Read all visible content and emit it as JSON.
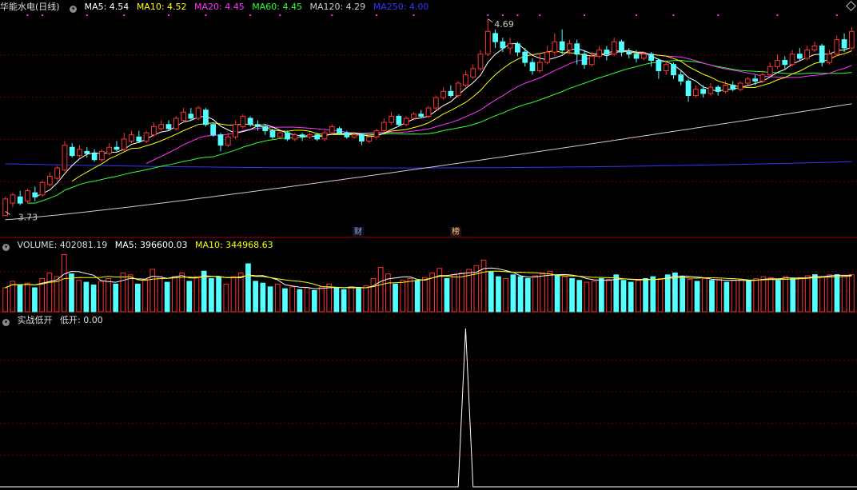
{
  "main_header": {
    "title": "华能水电(日线)",
    "ma5": {
      "label": "MA5: 4.54",
      "color": "#ffffff"
    },
    "ma10": {
      "label": "MA10: 4.52",
      "color": "#ffff00"
    },
    "ma20": {
      "label": "MA20: 4.45",
      "color": "#ff33ff"
    },
    "ma60": {
      "label": "MA60: 4.45",
      "color": "#33ff33"
    },
    "ma120": {
      "label": "MA120: 4.29",
      "color": "#cccccc"
    },
    "ma250": {
      "label": "MA250: 4.00",
      "color": "#3333ff"
    }
  },
  "annotations": {
    "high_label": "4.69",
    "low_label": "3.73",
    "tag_cai": "财",
    "tag_bang": "榜"
  },
  "vol_header": {
    "title": "VOLUME: 402081.19",
    "ma5": {
      "label": "MA5: 396600.03",
      "color": "#ffffff"
    },
    "ma10": {
      "label": "MA10: 344968.63",
      "color": "#ffff00"
    }
  },
  "ind_header": {
    "title": "实战低开",
    "value": "低开: 0.00"
  },
  "colors": {
    "up": "#ff3232",
    "down": "#54ffff",
    "grid": "#6b0000",
    "border": "#a00000"
  },
  "chart_data": [
    {
      "type": "candlestick",
      "title": "华能水电(日线)",
      "ylim": [
        3.7,
        4.72
      ],
      "candles": [
        [
          3.74,
          3.82,
          3.76,
          3.83
        ],
        [
          3.8,
          3.84,
          3.78,
          3.85
        ],
        [
          3.83,
          3.8,
          3.79,
          3.86
        ],
        [
          3.81,
          3.86,
          3.8,
          3.87
        ],
        [
          3.85,
          3.83,
          3.81,
          3.88
        ],
        [
          3.84,
          3.9,
          3.83,
          3.91
        ],
        [
          3.89,
          3.93,
          3.88,
          3.95
        ],
        [
          3.92,
          3.97,
          3.91,
          3.98
        ],
        [
          3.96,
          4.08,
          3.95,
          4.1
        ],
        [
          4.07,
          4.03,
          4.02,
          4.09
        ],
        [
          4.03,
          4.06,
          4.02,
          4.08
        ],
        [
          4.05,
          4.04,
          4.02,
          4.07
        ],
        [
          4.04,
          4.01,
          4.0,
          4.06
        ],
        [
          4.01,
          4.05,
          4.0,
          4.06
        ],
        [
          4.04,
          4.07,
          4.03,
          4.09
        ],
        [
          4.07,
          4.06,
          4.05,
          4.1
        ],
        [
          4.06,
          4.11,
          4.05,
          4.14
        ],
        [
          4.1,
          4.13,
          4.09,
          4.15
        ],
        [
          4.12,
          4.1,
          4.09,
          4.15
        ],
        [
          4.1,
          4.14,
          4.09,
          4.15
        ],
        [
          4.13,
          4.17,
          4.12,
          4.19
        ],
        [
          4.16,
          4.18,
          4.15,
          4.2
        ],
        [
          4.18,
          4.16,
          4.15,
          4.2
        ],
        [
          4.16,
          4.21,
          4.15,
          4.22
        ],
        [
          4.2,
          4.24,
          4.19,
          4.26
        ],
        [
          4.23,
          4.21,
          4.2,
          4.26
        ],
        [
          4.21,
          4.26,
          4.2,
          4.27
        ],
        [
          4.25,
          4.18,
          4.17,
          4.26
        ],
        [
          4.18,
          4.13,
          4.12,
          4.19
        ],
        [
          4.13,
          4.08,
          4.05,
          4.14
        ],
        [
          4.08,
          4.12,
          4.07,
          4.14
        ],
        [
          4.12,
          4.18,
          4.11,
          4.2
        ],
        [
          4.17,
          4.22,
          4.16,
          4.23
        ],
        [
          4.21,
          4.18,
          4.17,
          4.22
        ],
        [
          4.18,
          4.17,
          4.15,
          4.2
        ],
        [
          4.17,
          4.15,
          4.13,
          4.18
        ],
        [
          4.15,
          4.12,
          4.11,
          4.16
        ],
        [
          4.12,
          4.14,
          4.11,
          4.15
        ],
        [
          4.14,
          4.11,
          4.1,
          4.15
        ],
        [
          4.11,
          4.13,
          4.1,
          4.14
        ],
        [
          4.13,
          4.12,
          4.1,
          4.14
        ],
        [
          4.12,
          4.13,
          4.11,
          4.14
        ],
        [
          4.13,
          4.11,
          4.1,
          4.14
        ],
        [
          4.11,
          4.14,
          4.1,
          4.15
        ],
        [
          4.14,
          4.17,
          4.13,
          4.18
        ],
        [
          4.16,
          4.14,
          4.13,
          4.17
        ],
        [
          4.14,
          4.12,
          4.11,
          4.15
        ],
        [
          4.12,
          4.13,
          4.11,
          4.14
        ],
        [
          4.13,
          4.1,
          4.08,
          4.14
        ],
        [
          4.1,
          4.12,
          4.09,
          4.13
        ],
        [
          4.12,
          4.15,
          4.11,
          4.16
        ],
        [
          4.15,
          4.19,
          4.14,
          4.21
        ],
        [
          4.19,
          4.22,
          4.18,
          4.24
        ],
        [
          4.22,
          4.18,
          4.17,
          4.23
        ],
        [
          4.18,
          4.21,
          4.17,
          4.22
        ],
        [
          4.21,
          4.23,
          4.2,
          4.24
        ],
        [
          4.23,
          4.22,
          4.21,
          4.25
        ],
        [
          4.22,
          4.26,
          4.21,
          4.27
        ],
        [
          4.26,
          4.31,
          4.25,
          4.32
        ],
        [
          4.31,
          4.34,
          4.3,
          4.36
        ],
        [
          4.34,
          4.32,
          4.31,
          4.37
        ],
        [
          4.32,
          4.38,
          4.31,
          4.39
        ],
        [
          4.37,
          4.42,
          4.36,
          4.44
        ],
        [
          4.41,
          4.45,
          4.4,
          4.47
        ],
        [
          4.45,
          4.52,
          4.44,
          4.54
        ],
        [
          4.52,
          4.63,
          4.51,
          4.69
        ],
        [
          4.62,
          4.58,
          4.55,
          4.64
        ],
        [
          4.58,
          4.55,
          4.53,
          4.6
        ],
        [
          4.55,
          4.57,
          4.52,
          4.6
        ],
        [
          4.57,
          4.53,
          4.51,
          4.58
        ],
        [
          4.53,
          4.48,
          4.46,
          4.55
        ],
        [
          4.48,
          4.44,
          4.42,
          4.5
        ],
        [
          4.44,
          4.48,
          4.43,
          4.52
        ],
        [
          4.48,
          4.53,
          4.47,
          4.56
        ],
        [
          4.53,
          4.58,
          4.51,
          4.62
        ],
        [
          4.58,
          4.54,
          4.52,
          4.64
        ],
        [
          4.54,
          4.57,
          4.52,
          4.59
        ],
        [
          4.57,
          4.52,
          4.47,
          4.59
        ],
        [
          4.52,
          4.47,
          4.45,
          4.54
        ],
        [
          4.47,
          4.51,
          4.46,
          4.53
        ],
        [
          4.51,
          4.54,
          4.5,
          4.56
        ],
        [
          4.54,
          4.52,
          4.49,
          4.56
        ],
        [
          4.52,
          4.58,
          4.51,
          4.6
        ],
        [
          4.58,
          4.53,
          4.51,
          4.59
        ],
        [
          4.53,
          4.52,
          4.5,
          4.55
        ],
        [
          4.52,
          4.5,
          4.48,
          4.54
        ],
        [
          4.5,
          4.52,
          4.49,
          4.53
        ],
        [
          4.52,
          4.49,
          4.46,
          4.53
        ],
        [
          4.49,
          4.44,
          4.4,
          4.5
        ],
        [
          4.44,
          4.47,
          4.42,
          4.49
        ],
        [
          4.47,
          4.42,
          4.4,
          4.48
        ],
        [
          4.42,
          4.39,
          4.37,
          4.44
        ],
        [
          4.39,
          4.32,
          4.29,
          4.4
        ],
        [
          4.32,
          4.35,
          4.31,
          4.37
        ],
        [
          4.35,
          4.33,
          4.31,
          4.37
        ],
        [
          4.33,
          4.36,
          4.32,
          4.38
        ],
        [
          4.36,
          4.34,
          4.32,
          4.37
        ],
        [
          4.34,
          4.37,
          4.33,
          4.39
        ],
        [
          4.37,
          4.35,
          4.34,
          4.39
        ],
        [
          4.35,
          4.38,
          4.34,
          4.39
        ],
        [
          4.38,
          4.4,
          4.37,
          4.41
        ],
        [
          4.4,
          4.39,
          4.37,
          4.42
        ],
        [
          4.39,
          4.42,
          4.38,
          4.44
        ],
        [
          4.42,
          4.46,
          4.41,
          4.48
        ],
        [
          4.46,
          4.49,
          4.45,
          4.52
        ],
        [
          4.49,
          4.47,
          4.45,
          4.51
        ],
        [
          4.47,
          4.52,
          4.46,
          4.54
        ],
        [
          4.52,
          4.5,
          4.49,
          4.55
        ],
        [
          4.5,
          4.54,
          4.49,
          4.56
        ],
        [
          4.54,
          4.56,
          4.53,
          4.58
        ],
        [
          4.56,
          4.48,
          4.46,
          4.57
        ],
        [
          4.48,
          4.52,
          4.47,
          4.54
        ],
        [
          4.52,
          4.59,
          4.51,
          4.61
        ],
        [
          4.59,
          4.55,
          4.53,
          4.62
        ],
        [
          4.55,
          4.63,
          4.54,
          4.65
        ]
      ]
    },
    {
      "type": "bar",
      "title": "VOLUME",
      "ylim": [
        0,
        650000
      ],
      "values": [
        260000,
        330000,
        290000,
        310000,
        260000,
        360000,
        420000,
        380000,
        620000,
        410000,
        340000,
        320000,
        290000,
        330000,
        360000,
        300000,
        420000,
        400000,
        300000,
        350000,
        460000,
        380000,
        320000,
        380000,
        420000,
        330000,
        380000,
        440000,
        360000,
        380000,
        300000,
        380000,
        420000,
        520000,
        330000,
        310000,
        270000,
        300000,
        250000,
        270000,
        240000,
        260000,
        230000,
        270000,
        300000,
        260000,
        240000,
        270000,
        250000,
        280000,
        360000,
        480000,
        410000,
        300000,
        340000,
        360000,
        340000,
        370000,
        420000,
        470000,
        360000,
        400000,
        420000,
        460000,
        500000,
        560000,
        430000,
        380000,
        360000,
        400000,
        380000,
        360000,
        390000,
        410000,
        440000,
        400000,
        380000,
        360000,
        340000,
        320000,
        330000,
        360000,
        350000,
        400000,
        340000,
        320000,
        340000,
        360000,
        380000,
        360000,
        400000,
        420000,
        380000,
        350000,
        330000,
        360000,
        340000,
        350000,
        320000,
        340000,
        350000,
        330000,
        360000,
        380000,
        370000,
        340000,
        380000,
        360000,
        370000,
        390000,
        402081,
        380000,
        400000,
        402081,
        390000,
        402081
      ],
      "ma5": [
        396600.03
      ],
      "ma10": [
        344968.63
      ]
    },
    {
      "type": "line",
      "title": "实战低开",
      "ylim": [
        0,
        1
      ],
      "spikes": [
        62,
        117
      ],
      "value": "0.00"
    }
  ]
}
